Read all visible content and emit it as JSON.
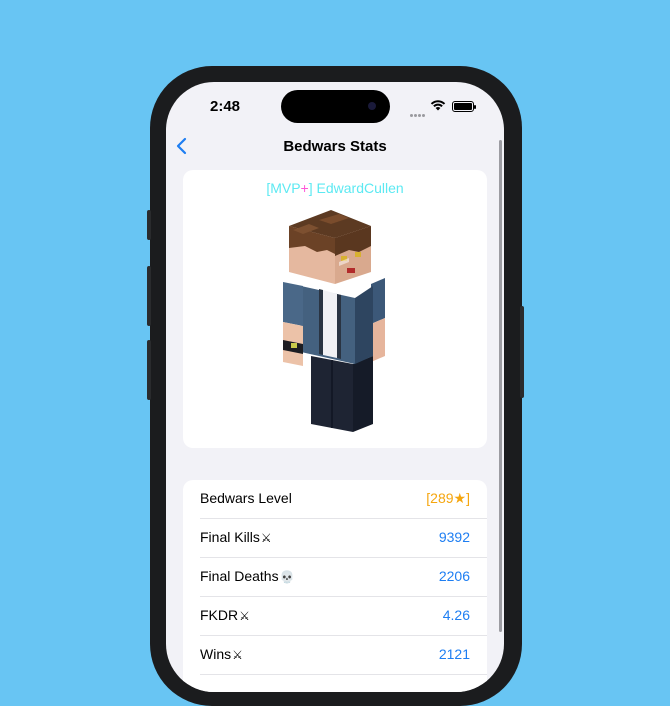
{
  "status_bar": {
    "time": "2:48"
  },
  "nav": {
    "title": "Bedwars Stats",
    "back_icon": "chevron-left-icon"
  },
  "player": {
    "rank_open": "[MVP",
    "rank_plus": "+",
    "rank_close": "]",
    "name": "EdwardCullen",
    "rank_color": "#5ce9f2",
    "plus_color": "#ff57d8"
  },
  "stats": [
    {
      "label": "Bedwars Level",
      "icon": "",
      "value": "[289★]",
      "color": "#f5a60f"
    },
    {
      "label": "Final Kills",
      "icon": "⚔",
      "value": "9392",
      "color": "#1e7ef2"
    },
    {
      "label": "Final Deaths",
      "icon": "💀",
      "value": "2206",
      "color": "#1e7ef2"
    },
    {
      "label": "FKDR",
      "icon": "⚔",
      "value": "4.26",
      "color": "#1e7ef2"
    },
    {
      "label": "Wins",
      "icon": "⚔",
      "value": "2121",
      "color": "#1e7ef2"
    }
  ],
  "colors": {
    "background": "#68c5f3",
    "accent": "#1e7ef2",
    "screen": "#f2f2f7"
  }
}
